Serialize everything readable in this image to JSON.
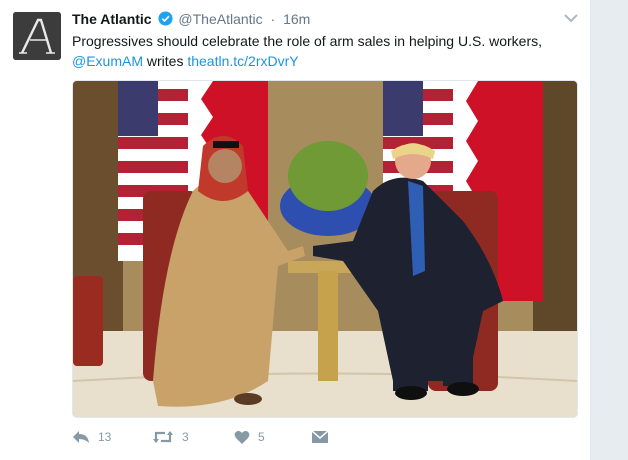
{
  "account": {
    "name": "The Atlantic",
    "handle": "@TheAtlantic",
    "separator": "·",
    "time": "16m"
  },
  "tweet": {
    "text_main": "Progressives should celebrate the role of arm sales in helping U.S. workers,",
    "mention": "@ExumAM",
    "text_mid": " writes ",
    "link": "theatln.tc/2rxDvrY"
  },
  "media": {
    "description_icon": "photo-handshake"
  },
  "actions": {
    "reply_count": "13",
    "retweet_count": "3",
    "like_count": "5"
  },
  "colors": {
    "link": "#1b95e0",
    "verified": "#1da1f2",
    "muted": "#657786",
    "action": "#8899a6"
  }
}
